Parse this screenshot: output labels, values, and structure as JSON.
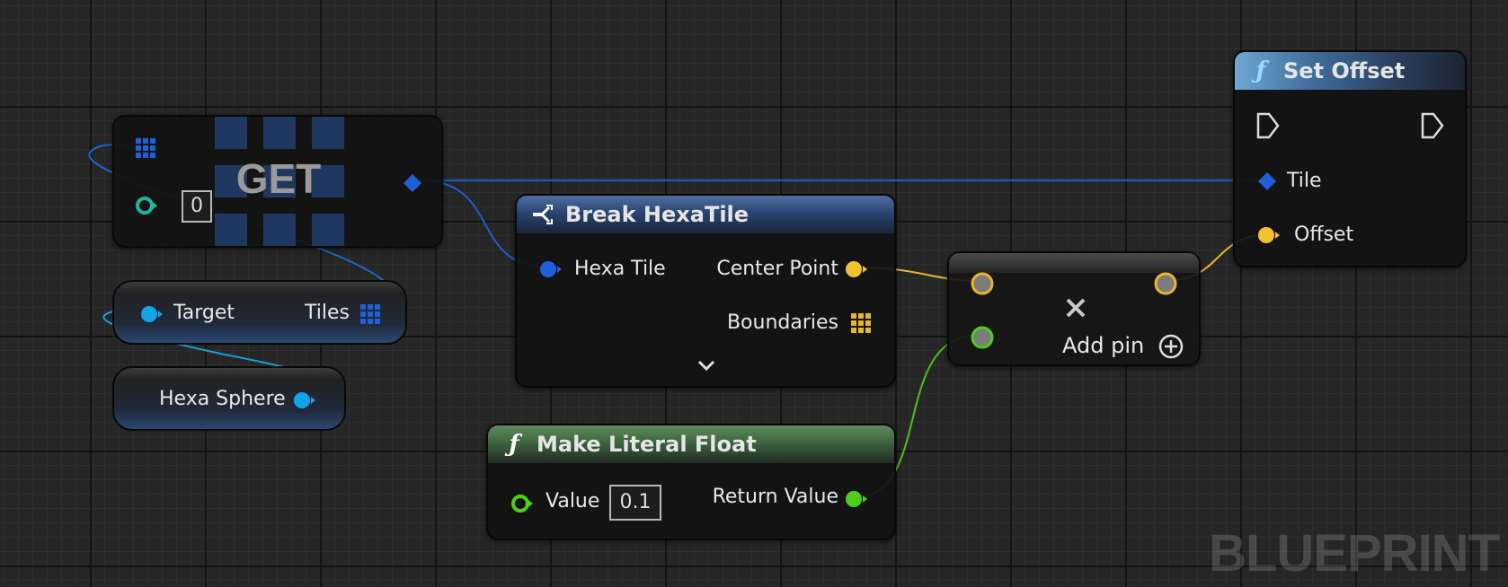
{
  "watermark": "BLUEPRINT",
  "colors": {
    "struct_pin": "#1f5fd8",
    "array_pin": "#1f5fd8",
    "object_pin": "#12a4e8",
    "vector_pin": "#f2c12e",
    "float_pin": "#4ccf17",
    "int_pin": "#1fb59a",
    "exec_pin": "#dcdcdc"
  },
  "nodes": {
    "get": {
      "title": "GET",
      "index_value": "0"
    },
    "target": {
      "input_label": "Target",
      "output_label": "Tiles"
    },
    "hexa_sphere": {
      "label": "Hexa Sphere"
    },
    "break_tile": {
      "title": "Break HexaTile",
      "input_label": "Hexa Tile",
      "output_center": "Center Point",
      "output_boundaries": "Boundaries"
    },
    "literal_float": {
      "title": "Make Literal Float",
      "value_label": "Value",
      "value": "0.1",
      "output_label": "Return Value"
    },
    "multiply": {
      "add_pin_label": "Add pin"
    },
    "set_offset": {
      "title": "Set Offset",
      "tile_label": "Tile",
      "offset_label": "Offset"
    }
  },
  "icons": {
    "break_struct": "break-struct-icon",
    "function": "function-icon",
    "multiply": "multiply-icon",
    "add": "add-pin-icon",
    "expand": "chevron-down-icon"
  }
}
